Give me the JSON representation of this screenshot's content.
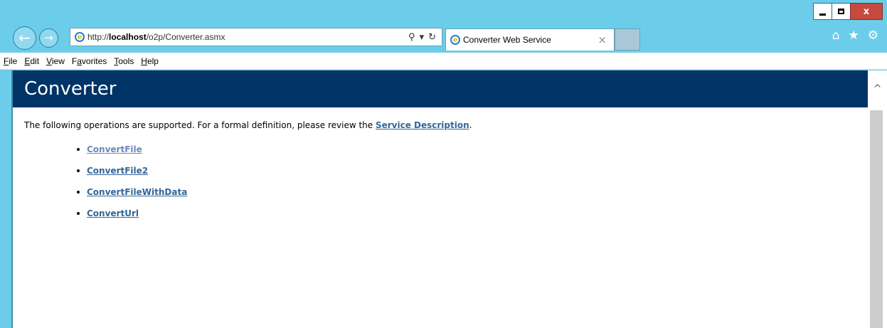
{
  "window": {
    "controls": {
      "minimize": "",
      "maximize": "",
      "close": "x"
    }
  },
  "navigation": {
    "back_icon": "←",
    "forward_icon": "→",
    "address": {
      "prefix": "http://",
      "host": "localhost",
      "path": "/o2p/Converter.asmx",
      "search_icon": "⚲",
      "dropdown_icon": "▾",
      "refresh_icon": "↻"
    },
    "tab": {
      "title": "Converter Web Service",
      "close": "×"
    },
    "toolbar_icons": {
      "home": "⌂",
      "favorites": "★",
      "settings": "⚙"
    }
  },
  "menubar": {
    "items": [
      {
        "mnemonic": "F",
        "rest": "ile"
      },
      {
        "mnemonic": "E",
        "rest": "dit"
      },
      {
        "mnemonic": "V",
        "rest": "iew"
      },
      {
        "pre": "F",
        "mnemonic": "a",
        "rest": "vorites"
      },
      {
        "mnemonic": "T",
        "rest": "ools"
      },
      {
        "mnemonic": "H",
        "rest": "elp"
      }
    ]
  },
  "page": {
    "heading": "Converter",
    "intro_text": "The following operations are supported. For a formal definition, please review the ",
    "service_link": "Service Description",
    "intro_end": ".",
    "operations": [
      "ConvertFile",
      "ConvertFile2",
      "ConvertFileWithData",
      "ConvertUrl"
    ]
  },
  "colors": {
    "chrome": "#6ccdea",
    "header_band": "#003366",
    "link": "#336699",
    "visited_link": "#6a8bb8"
  }
}
